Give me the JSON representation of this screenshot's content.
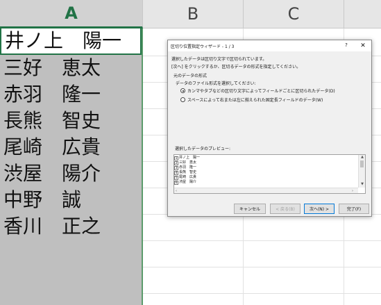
{
  "spreadsheet": {
    "columns": [
      {
        "label": "A"
      },
      {
        "label": "B"
      },
      {
        "label": "C"
      }
    ],
    "column_a_cells": [
      "井ノ上　陽一",
      "三好　恵太",
      "赤羽　隆一",
      "長熊　智史",
      "尾崎　広貴",
      "渋屋　陽介",
      "中野　誠",
      "香川　正之"
    ]
  },
  "dialog": {
    "title": "区切り位置指定ウィザード - 1 / 3",
    "help_label": "?",
    "close_label": "✕",
    "line1": "選択したデータは区切り文字で区切られています。",
    "line2": "[次へ] をクリックするか、区切るデータの形式を指定してください。",
    "group_title": "元のデータの形式",
    "prompt": "データのファイル形式を選択してください:",
    "options": [
      {
        "label": "カンマやタブなどの区切り文字によってフィールドごとに区切られたデータ(D)",
        "checked": true
      },
      {
        "label": "スペースによって右または左に揃えられた固定長フィールドのデータ(W)",
        "checked": false
      }
    ],
    "preview_label": "選択したデータのプレビュー:",
    "preview_lines": [
      {
        "num": "1",
        "text": "井ノ上　陽一"
      },
      {
        "num": "2",
        "text": "三好　恵太"
      },
      {
        "num": "3",
        "text": "赤羽　隆一"
      },
      {
        "num": "4",
        "text": "長熊　智史"
      },
      {
        "num": "5",
        "text": "尾崎　広貴"
      },
      {
        "num": "6",
        "text": "渋屋　陽介"
      }
    ],
    "buttons": {
      "cancel": "キャンセル",
      "back": "< 戻る(B)",
      "next": "次へ(N) >",
      "finish": "完了(F)"
    }
  },
  "colors": {
    "accent_green": "#217346",
    "selection_gray": "#bfbfbf"
  }
}
